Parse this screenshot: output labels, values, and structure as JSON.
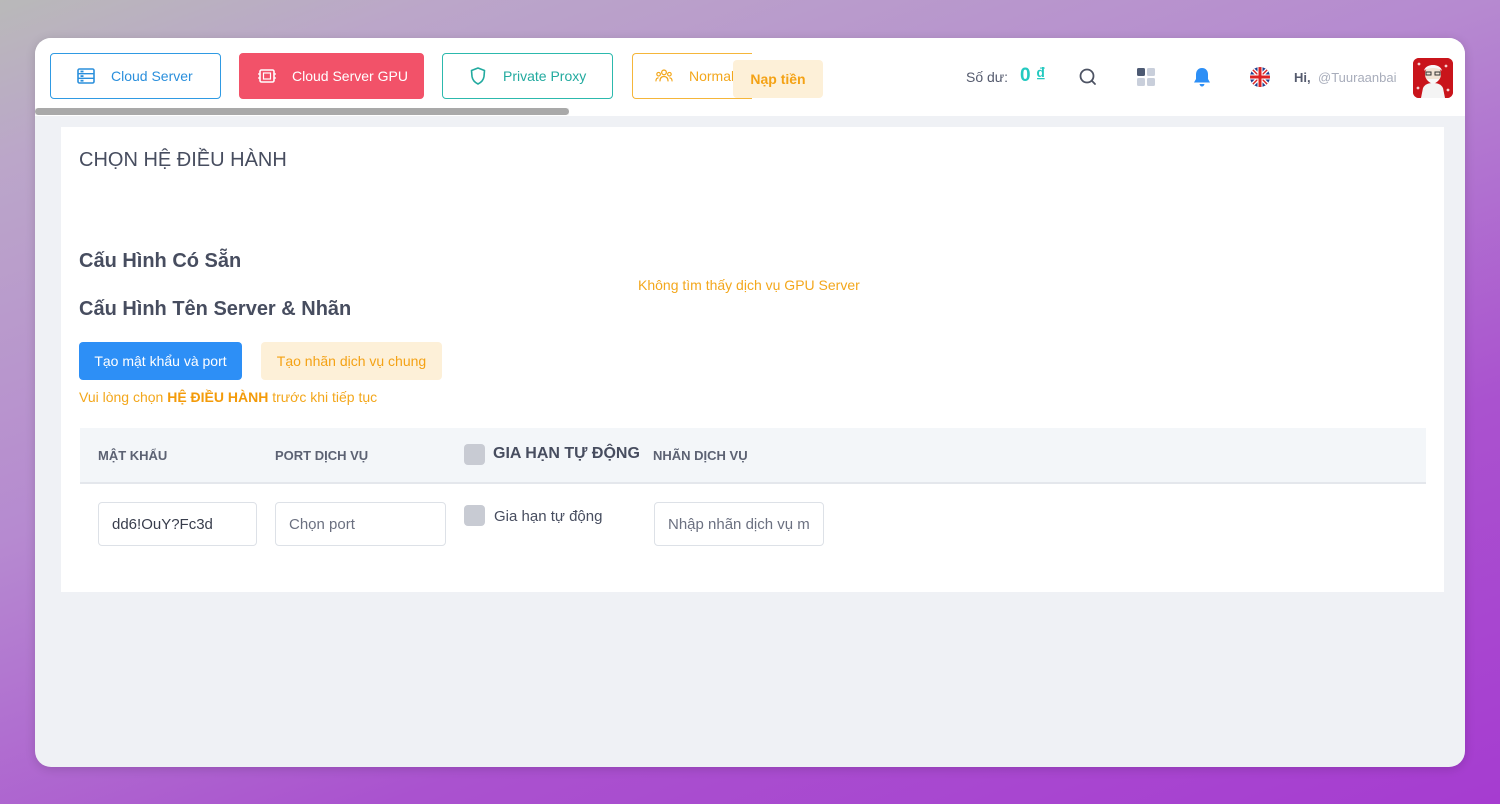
{
  "tabs": [
    {
      "label": "Cloud Server",
      "icon": "server-list-icon"
    },
    {
      "label": "Cloud Server GPU",
      "icon": "chip-icon"
    },
    {
      "label": "Private Proxy",
      "icon": "shield-icon"
    },
    {
      "label": "Normal P",
      "icon": "users-icon"
    }
  ],
  "header": {
    "topup_label": "Nạp tiền",
    "balance_label": "Số dư:",
    "balance_value": "0 ₫",
    "greeting": "Hi,",
    "username": "@Tuuraanbai"
  },
  "main": {
    "os_title": "CHỌN HỆ ĐIỀU HÀNH",
    "preset_heading": "Cấu Hình Có Sẵn",
    "not_found": "Không tìm thấy dịch vụ GPU Server",
    "name_heading": "Cấu Hình Tên Server & Nhãn",
    "btn_password_port": "Tạo mật khẩu và port",
    "btn_common_label": "Tạo nhãn dịch vụ chung",
    "warning_prefix": "Vui lòng chọn ",
    "warning_bold": "HỆ ĐIỀU HÀNH",
    "warning_suffix": " trước khi tiếp tục"
  },
  "table": {
    "col_password": "MẬT KHẨU",
    "col_port": "PORT DỊCH VỤ",
    "col_auto_renew": "GIA HẠN TỰ ĐỘNG",
    "col_label": "NHÃN DỊCH VỤ",
    "row": {
      "password_value": "dd6!OuY?Fc3d",
      "port_placeholder": "Chọn port",
      "auto_renew_label": "Gia hạn tự động",
      "label_placeholder": "Nhập nhãn dịch vụ máy chủ"
    }
  },
  "colors": {
    "cloud": "#2f9ae3",
    "gpu": "#f25269",
    "proxy": "#2cb9ad",
    "normal": "#f5b63a",
    "primary": "#2d8ff6",
    "balance": "#24c9c0"
  }
}
